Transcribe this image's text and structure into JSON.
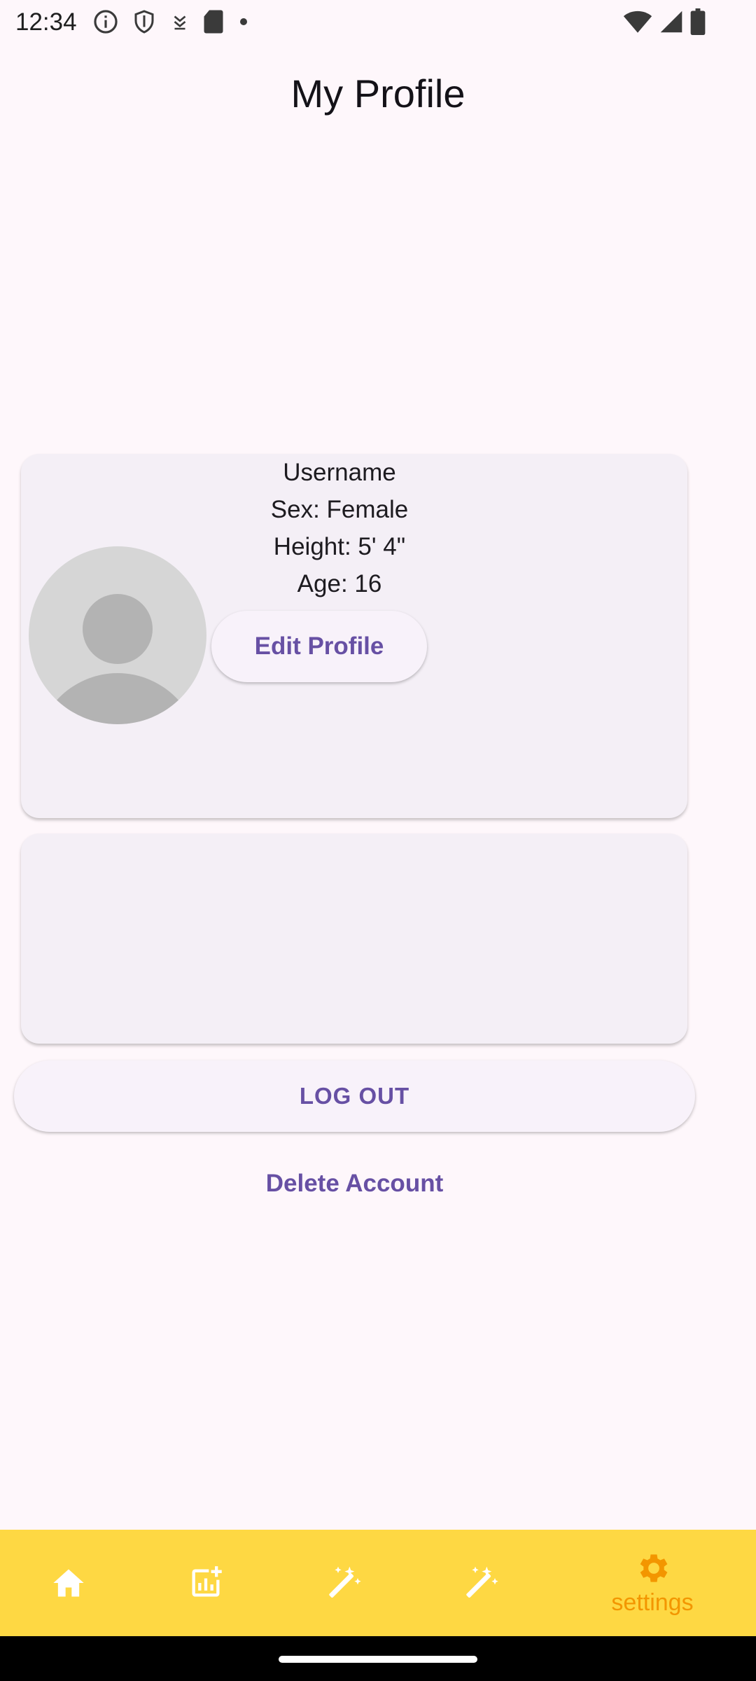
{
  "status_bar": {
    "time": "12:34",
    "left_icons": [
      "info-icon",
      "shield-icon",
      "download-icon",
      "sd-card-icon",
      "dot-icon"
    ],
    "right_icons": [
      "wifi-icon",
      "signal-icon",
      "battery-icon"
    ]
  },
  "header": {
    "title": "My Profile"
  },
  "profile": {
    "username": "Username",
    "sex": "Sex: Female",
    "height": "Height: 5' 4\"",
    "age": "Age: 16",
    "edit_button": "Edit Profile",
    "avatar_icon": "person-icon"
  },
  "actions": {
    "logout": "LOG OUT",
    "delete": "Delete Account"
  },
  "bottom_nav": {
    "items": [
      {
        "icon": "home-icon",
        "label": ""
      },
      {
        "icon": "chart-add-icon",
        "label": ""
      },
      {
        "icon": "magic-wand-icon",
        "label": ""
      },
      {
        "icon": "magic-wand-icon",
        "label": ""
      },
      {
        "icon": "gear-icon",
        "label": "settings",
        "active": true
      }
    ]
  },
  "colors": {
    "background": "#fef7fb",
    "card": "#f4eff6",
    "primary": "#6750a4",
    "nav_bar": "#fed843",
    "nav_active": "#f39600"
  }
}
